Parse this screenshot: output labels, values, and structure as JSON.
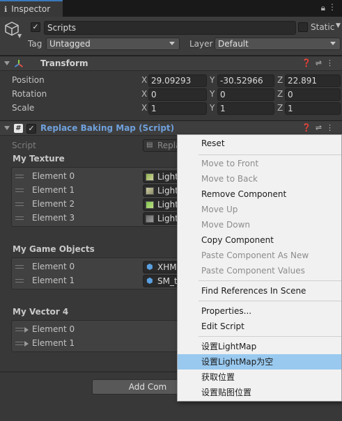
{
  "window": {
    "tab_title": "Inspector"
  },
  "gameobject": {
    "name": "Scripts",
    "static_label": "Static",
    "tag_label": "Tag",
    "tag_value": "Untagged",
    "layer_label": "Layer",
    "layer_value": "Default"
  },
  "transform": {
    "title": "Transform",
    "rows": [
      {
        "label": "Position",
        "x": "29.09293",
        "y": "-30.52966",
        "z": "22.891"
      },
      {
        "label": "Rotation",
        "x": "0",
        "y": "0",
        "z": "0"
      },
      {
        "label": "Scale",
        "x": "1",
        "y": "1",
        "z": "1"
      }
    ],
    "x": "X",
    "y": "Y",
    "z": "Z"
  },
  "script_comp": {
    "title": "Replace Baking Map (Script)",
    "script_label": "Script",
    "script_value": "Replac",
    "my_texture": {
      "label": "My Texture",
      "items": [
        {
          "label": "Element 0",
          "value": "Lightn"
        },
        {
          "label": "Element 1",
          "value": "Lightn"
        },
        {
          "label": "Element 2",
          "value": "Lightn"
        },
        {
          "label": "Element 3",
          "value": "Lightn"
        }
      ]
    },
    "my_game_objects": {
      "label": "My Game Objects",
      "items": [
        {
          "label": "Element 0",
          "value": "XHMe"
        },
        {
          "label": "Element 1",
          "value": "SM_tr"
        }
      ]
    },
    "my_vector4": {
      "label": "My Vector 4",
      "items": [
        {
          "label": "Element 0"
        },
        {
          "label": "Element 1"
        }
      ]
    },
    "add_component": "Add Com"
  },
  "menu": {
    "items": [
      "Reset",
      "Move to Front",
      "Move to Back",
      "Remove Component",
      "Move Up",
      "Move Down",
      "Copy Component",
      "Paste Component As New",
      "Paste Component Values",
      "Find References In Scene",
      "Properties...",
      "Edit Script",
      "设置LightMap",
      "设置LightMap为空",
      "获取位置",
      "设置贴图位置"
    ]
  },
  "colors": {
    "accent": "#3a79bb",
    "menu_highlight": "#99c9ef",
    "script_title": "#6fa0db"
  }
}
